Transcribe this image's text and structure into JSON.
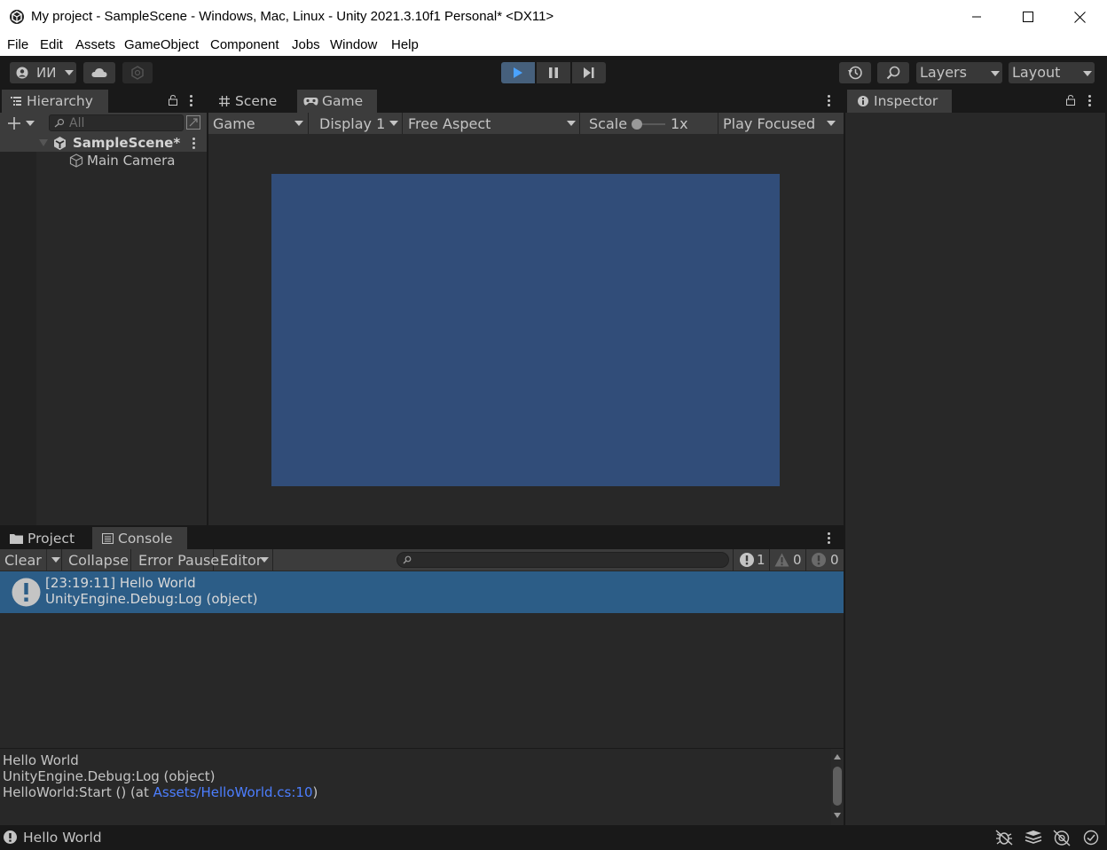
{
  "window": {
    "title": "My project - SampleScene - Windows, Mac, Linux - Unity 2021.3.10f1 Personal* <DX11>"
  },
  "menu": [
    "File",
    "Edit",
    "Assets",
    "GameObject",
    "Component",
    "Jobs",
    "Window",
    "Help"
  ],
  "toolbar": {
    "account_label": "ИИ",
    "layers_label": "Layers",
    "layout_label": "Layout"
  },
  "hierarchy": {
    "tab_label": "Hierarchy",
    "search_placeholder": "All",
    "scene_name": "SampleScene*",
    "items": [
      "Main Camera"
    ]
  },
  "game_view": {
    "tabs": [
      "Scene",
      "Game"
    ],
    "active_tab": "Game",
    "mode": "Game",
    "display": "Display 1",
    "aspect": "Free Aspect",
    "scale_label": "Scale",
    "scale_value": "1x",
    "play_mode": "Play Focused",
    "viewport_color": "#314d79"
  },
  "inspector": {
    "tab_label": "Inspector"
  },
  "console": {
    "tabs": [
      "Project",
      "Console"
    ],
    "active_tab": "Console",
    "clear_label": "Clear",
    "collapse_label": "Collapse",
    "error_pause_label": "Error Pause",
    "editor_label": "Editor",
    "log_count": "1",
    "warning_count": "0",
    "error_count": "0",
    "entries": [
      {
        "line1": "[23:19:11] Hello World",
        "line2": "UnityEngine.Debug:Log (object)"
      }
    ],
    "detail": {
      "line1": "Hello World",
      "line2": "UnityEngine.Debug:Log (object)",
      "line3_prefix": "HelloWorld:Start () (at ",
      "line3_link": "Assets/HelloWorld.cs:10",
      "line3_suffix": ")"
    }
  },
  "statusbar": {
    "message": "Hello World"
  },
  "colors": {
    "accent_blue": "#2c5d87",
    "link_blue": "#4c7eff",
    "play_active": "#46607c"
  }
}
